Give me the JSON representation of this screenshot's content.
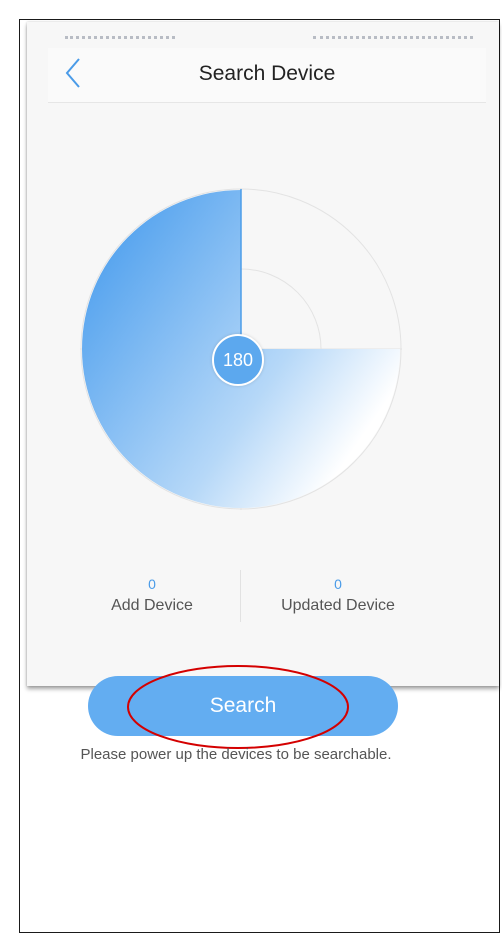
{
  "navbar": {
    "title": "Search Device",
    "back_icon": "chevron-left-icon"
  },
  "radar": {
    "count": "180",
    "sweep_fraction": 0.75
  },
  "stats": {
    "add": {
      "value": "0",
      "label": "Add Device"
    },
    "updated": {
      "value": "0",
      "label": "Updated Device"
    }
  },
  "search_button": {
    "label": "Search"
  },
  "hint": "Please power up the devices to be searchable.",
  "colors": {
    "accent": "#5ca8ee",
    "button": "#63adf1",
    "annotation": "#d40000"
  }
}
